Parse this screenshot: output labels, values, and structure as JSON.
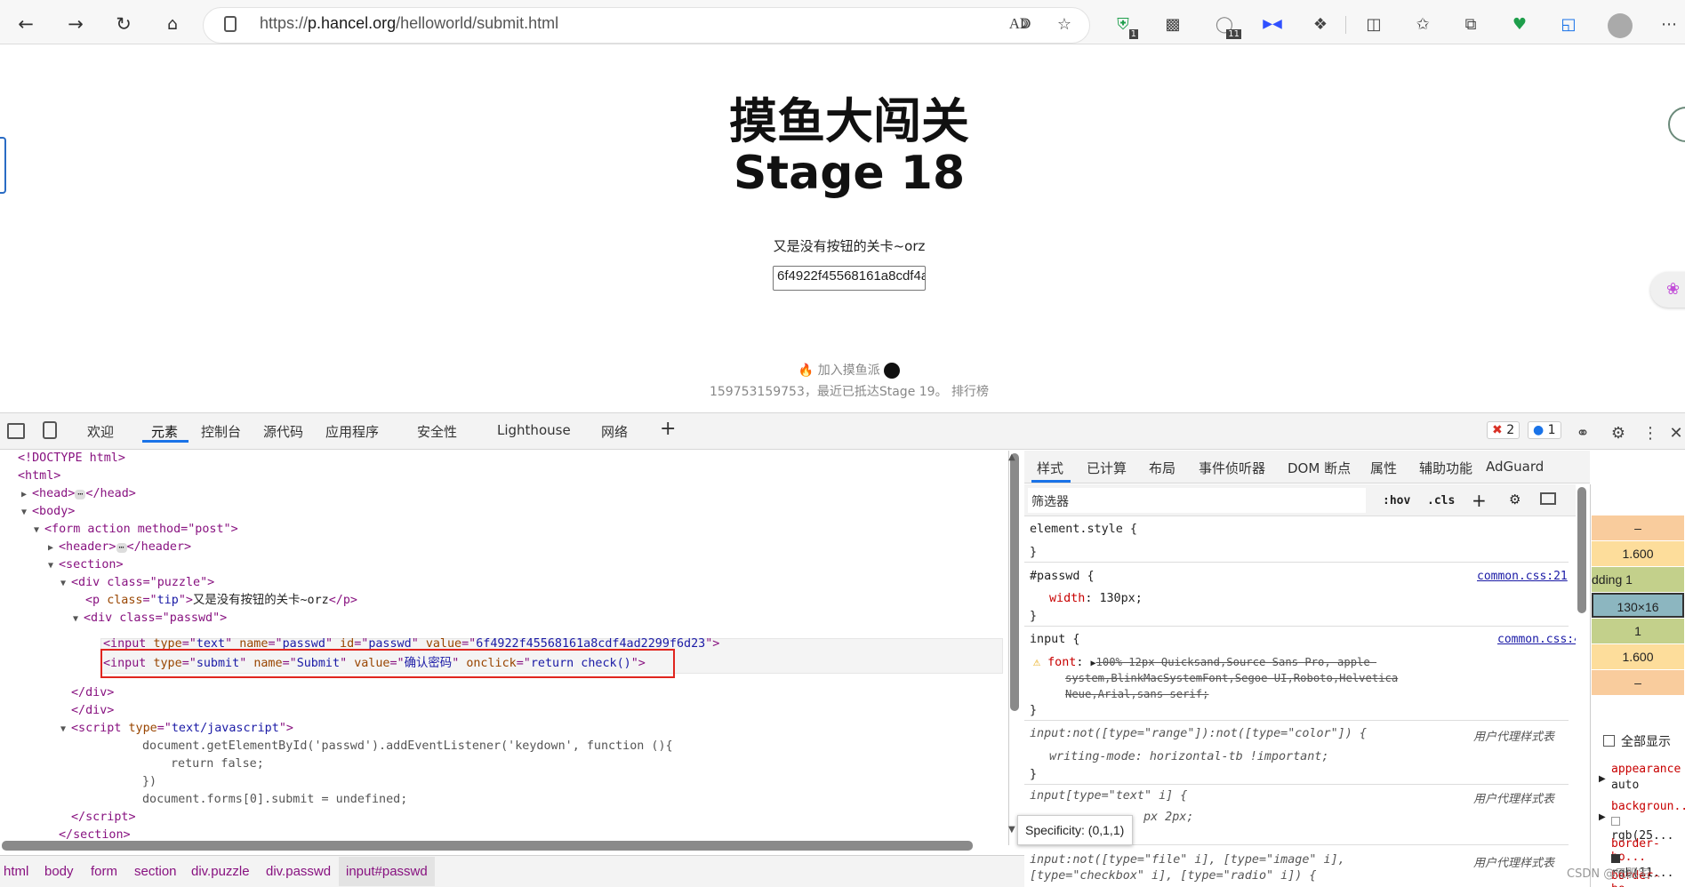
{
  "browser": {
    "url_prefix": "https://",
    "url_host": "p.hancel.org",
    "url_path": "/helloworld/submit.html",
    "badge_ext1": "1",
    "badge_ext2": "11"
  },
  "page": {
    "title": "摸鱼大闯关",
    "stage": "Stage 18",
    "tip": "又是没有按钮的关卡~orz",
    "passwd_value": "6f4922f45568161a8cdf4ad2299f6d23",
    "join_text": "加入摸鱼派",
    "stats_text": "159753159753，最近已抵达Stage 19。 排行榜"
  },
  "devtools": {
    "tabs": [
      "欢迎",
      "元素",
      "控制台",
      "源代码",
      "应用程序",
      "安全性",
      "Lighthouse",
      "网络"
    ],
    "errors": "2",
    "messages": "1",
    "dom_lines": [
      "<!DOCTYPE html>",
      "<html>",
      "<head>",
      "</head>",
      "<body>",
      "<form action method=\"post\">",
      "<header>",
      "</header>",
      "<section>",
      "<div class=\"puzzle\">",
      "又是没有按钮的关卡~orz",
      "<div class=\"passwd\">"
    ],
    "script_lines": [
      "document.getElementById('passwd').addEventListener('keydown', function (){",
      "return false;",
      "})",
      "document.forms[0].submit = undefined;"
    ],
    "crumbs": [
      "html",
      "body",
      "form",
      "section",
      "div.puzzle",
      "div.passwd",
      "input#passwd"
    ],
    "styles_tabs": [
      "样式",
      "已计算",
      "布局",
      "事件侦听器",
      "DOM 断点",
      "属性",
      "辅助功能",
      "AdGuard"
    ],
    "filter_placeholder": "筛选器",
    "hov": ":hov",
    "cls": ".cls",
    "element_style": "element.style {",
    "rule_passwd_selector": "#passwd {",
    "rule_passwd_prop": "width",
    "rule_passwd_val": "130px;",
    "rule_passwd_src": "common.css:21",
    "rule_input_selector": "input {",
    "rule_input_src": "common.css:4",
    "rule_input_font_a": "100% 12px Quicksand,Source Sans Pro,-apple-",
    "rule_input_font_b": "system,BlinkMacSystemFont,Segoe UI,Roboto,Helvetica",
    "rule_input_font_c": "Neue,Arial,sans-serif;",
    "ua_label": "用户代理样式表",
    "ua1_selector": "input:not([type=\"range\"]):not([type=\"color\"]) {",
    "ua1_prop": "writing-mode: horizontal-tb !important;",
    "ua2_selector": "input[type=\"text\" i] {",
    "ua2_tail": "px 2px;",
    "ua3_selector": "input:not([type=\"file\" i], [type=\"image\" i],",
    "ua3_tail": "[type=\"checkbox\" i], [type=\"radio\" i]) {",
    "specificity": "Specificity: (0,1,1)",
    "box_values": [
      "–",
      "1.600",
      "130×16",
      "1",
      "1.600",
      "–"
    ],
    "box_padding_label": "dding  1",
    "show_all": "全部显示",
    "computed_props": [
      "appearance",
      "auto",
      "backgroun...",
      "rgb(25...",
      "border-bo...",
      "rgb(11...",
      "border-bo..."
    ],
    "watermark": "CSDN @元肥宅..."
  }
}
